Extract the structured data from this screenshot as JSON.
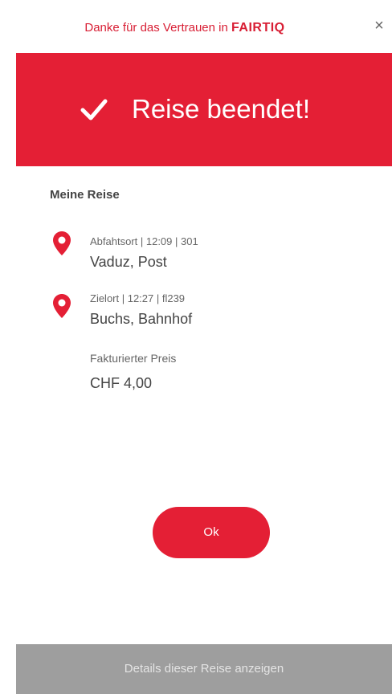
{
  "header": {
    "text": "Danke für das Vertrauen in",
    "brand": "FAIRTIQ",
    "close_icon": "close-icon",
    "close_label": "×"
  },
  "banner": {
    "icon": "checkmark-icon",
    "title": "Reise beendet!",
    "color": "#e41f35"
  },
  "trip": {
    "section_title": "Meine Reise",
    "departure": {
      "icon": "map-pin-icon",
      "meta": "Abfahtsort | 12:09 | 301",
      "name": "Vaduz, Post"
    },
    "destination": {
      "icon": "map-pin-icon",
      "meta": "Zielort | 12:27 | fl239",
      "name": "Buchs, Bahnhof"
    },
    "price": {
      "label": "Fakturierter Preis",
      "value": "CHF 4,00"
    }
  },
  "actions": {
    "ok_label": "Ok",
    "details_label": "Details dieser Reise anzeigen"
  },
  "colors": {
    "accent": "#e41f35",
    "details_bar": "#9e9e9e"
  }
}
